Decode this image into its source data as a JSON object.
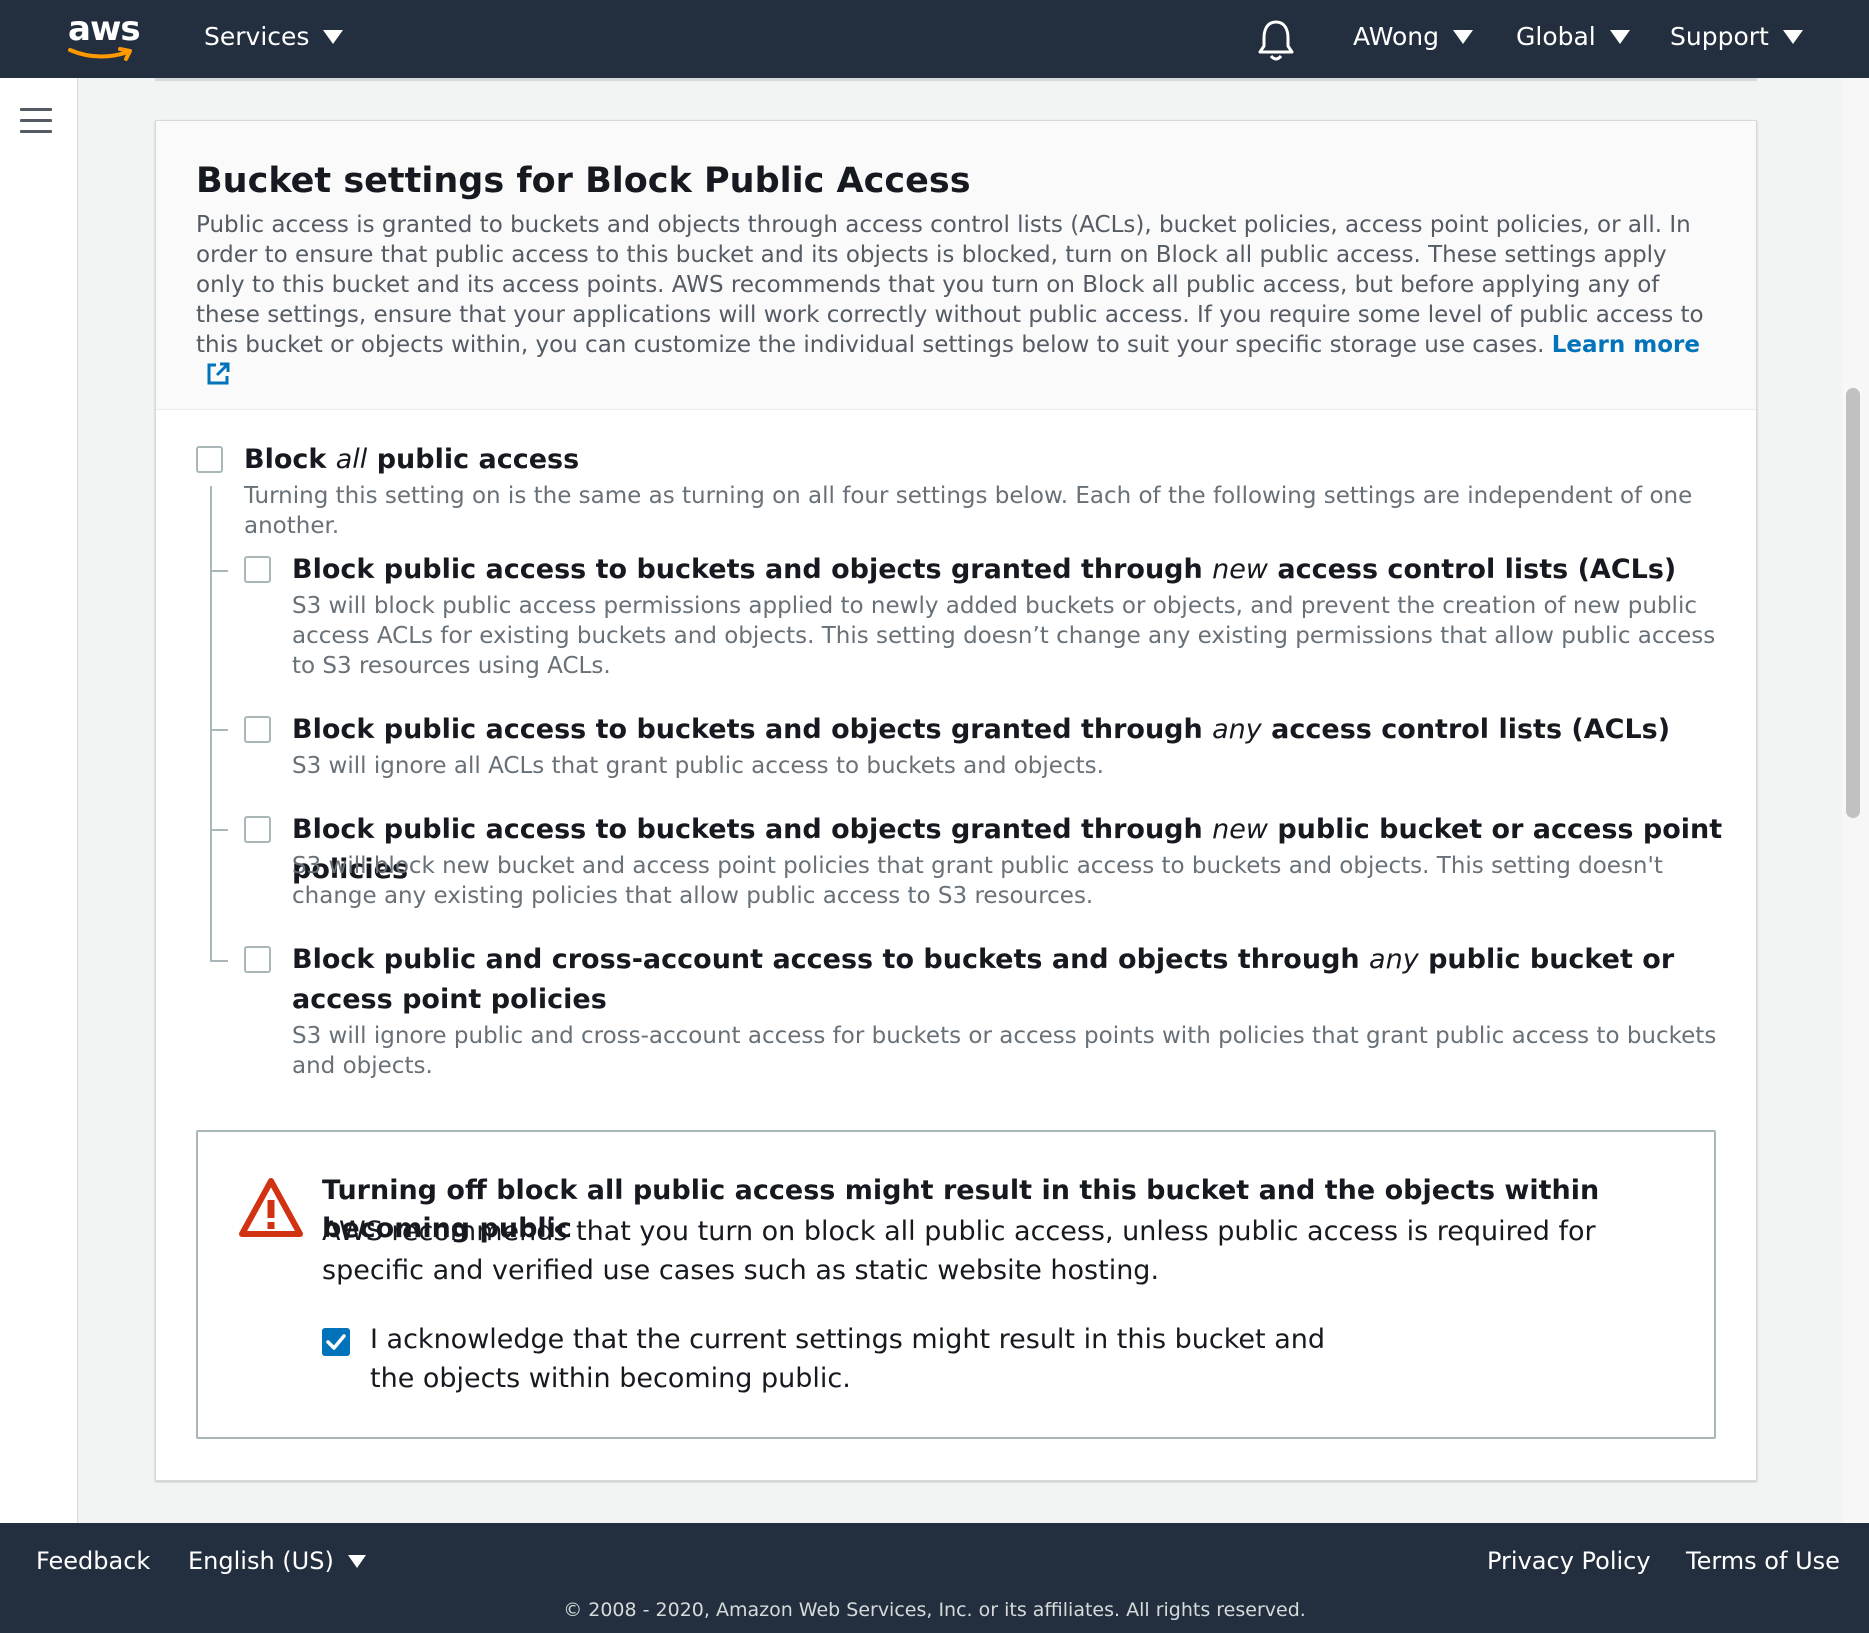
{
  "nav": {
    "logo": "aws",
    "services": "Services",
    "user": "AWong",
    "region": "Global",
    "support": "Support"
  },
  "panel": {
    "title": "Bucket settings for Block Public Access",
    "description": "Public access is granted to buckets and objects through access control lists (ACLs), bucket policies, access point policies, or all. In order to ensure that public access to this bucket and its objects is blocked, turn on Block all public access. These settings apply only to this bucket and its access points. AWS recommends that you turn on Block all public access, but before applying any of these settings, ensure that your applications will work correctly without public access. If you require some level of public access to this bucket or objects within, you can customize the individual settings below to suit your specific storage use cases.",
    "learn_more": "Learn more"
  },
  "block_all": {
    "pre": "Block ",
    "em": "all",
    "post": " public access",
    "desc": "Turning this setting on is the same as turning on all four settings below. Each of the following settings are independent of one another.",
    "checked": false
  },
  "options": [
    {
      "pre": "Block public access to buckets and objects granted through ",
      "em": "new",
      "post": " access control lists (ACLs)",
      "desc": "S3 will block public access permissions applied to newly added buckets or objects, and prevent the creation of new public access ACLs for existing buckets and objects. This setting doesn’t change any existing permissions that allow public access to S3 resources using ACLs.",
      "checked": false
    },
    {
      "pre": "Block public access to buckets and objects granted through ",
      "em": "any",
      "post": " access control lists (ACLs)",
      "desc": "S3 will ignore all ACLs that grant public access to buckets and objects.",
      "checked": false
    },
    {
      "pre": "Block public access to buckets and objects granted through ",
      "em": "new",
      "post": " public bucket or access point policies",
      "desc": "S3 will block new bucket and access point policies that grant public access to buckets and objects. This setting doesn't change any existing policies that allow public access to S3 resources.",
      "checked": false
    },
    {
      "pre": "Block public and cross-account access to buckets and objects through ",
      "em": "any",
      "post": " public bucket or access point policies",
      "desc": "S3 will ignore public and cross-account access for buckets or access points with policies that grant public access to buckets and objects.",
      "checked": false
    }
  ],
  "warning": {
    "title": "Turning off block all public access might result in this bucket and the objects within becoming public",
    "body": "AWS recommends that you turn on block all public access, unless public access is required for specific and verified use cases such as static website hosting.",
    "acknowledge": "I acknowledge that the current settings might result in this bucket and the objects within becoming public.",
    "acknowledged": true
  },
  "footer": {
    "feedback": "Feedback",
    "language": "English (US)",
    "privacy": "Privacy Policy",
    "terms": "Terms of Use",
    "copyright": "© 2008 - 2020, Amazon Web Services, Inc. or its affiliates. All rights reserved."
  },
  "colors": {
    "nav_bg": "#232f3e",
    "link": "#0073bb",
    "warning_red": "#d13212",
    "checkbox_checked": "#0073bb"
  },
  "icons": [
    "aws-logo",
    "caret-down-icon",
    "bell-icon",
    "hamburger-icon",
    "external-link-icon",
    "warning-icon",
    "checkmark-icon"
  ]
}
